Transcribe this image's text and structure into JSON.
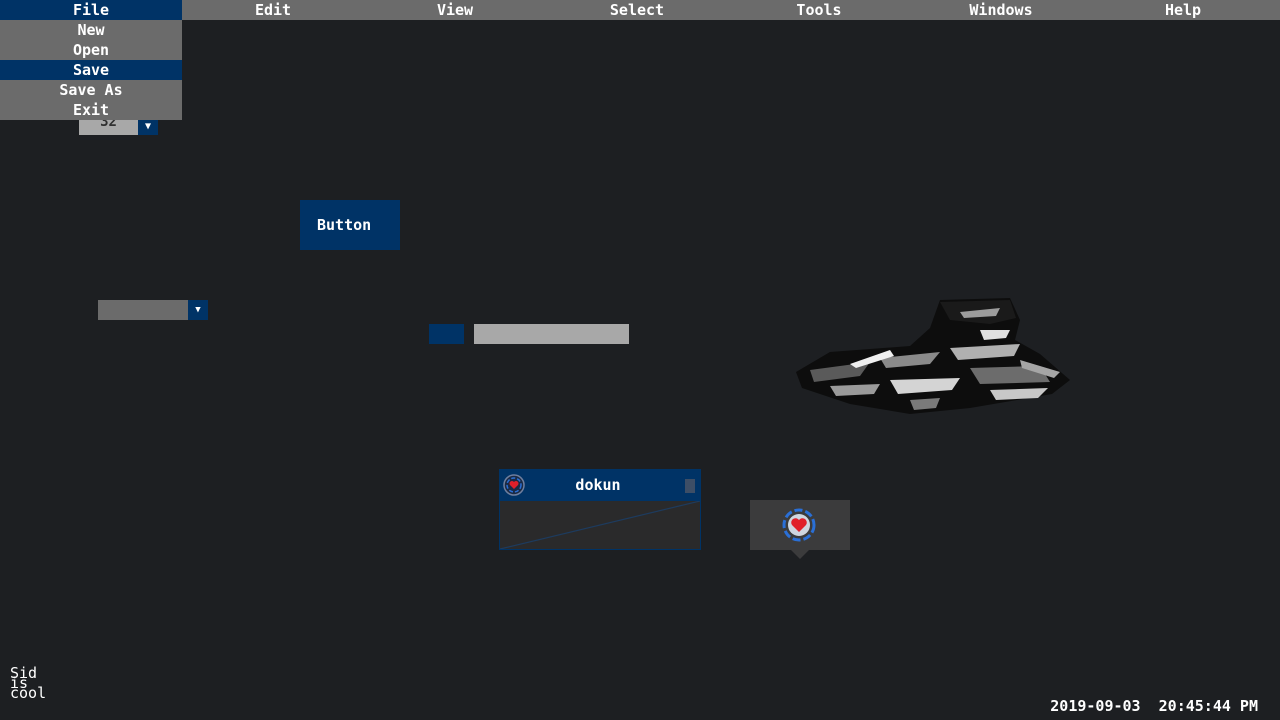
{
  "menubar": {
    "items": [
      {
        "label": "File"
      },
      {
        "label": "Edit"
      },
      {
        "label": "View"
      },
      {
        "label": "Select"
      },
      {
        "label": "Tools"
      },
      {
        "label": "Windows"
      },
      {
        "label": "Help"
      }
    ],
    "active_index": 0
  },
  "file_menu": {
    "items": [
      {
        "label": "New"
      },
      {
        "label": "Open"
      },
      {
        "label": "Save"
      },
      {
        "label": "Save As"
      },
      {
        "label": "Exit"
      }
    ],
    "highlighted_index": 2
  },
  "spinbox": {
    "value": "32",
    "up_icon": "triangle-up-icon",
    "down_icon": "triangle-down-icon"
  },
  "button": {
    "label": "Button"
  },
  "combo": {
    "value": "",
    "arrow_icon": "chevron-down-icon"
  },
  "slider": {
    "fill_fraction": 0.18
  },
  "window": {
    "title": "dokun",
    "icon": "heart-target-icon"
  },
  "tooltip": {
    "icon": "heart-target-icon"
  },
  "corner_label": {
    "lines": [
      "Sid",
      "is",
      "cool"
    ]
  },
  "status": {
    "date": "2019-09-03",
    "time": "20:45:44 PM"
  },
  "colors": {
    "background": "#1d1f22",
    "accent": "#003366",
    "menu_gray": "#6b6b6b",
    "light_gray": "#a8a8a8",
    "heart": "#e0202a",
    "ring_blue": "#2a6fd6"
  }
}
